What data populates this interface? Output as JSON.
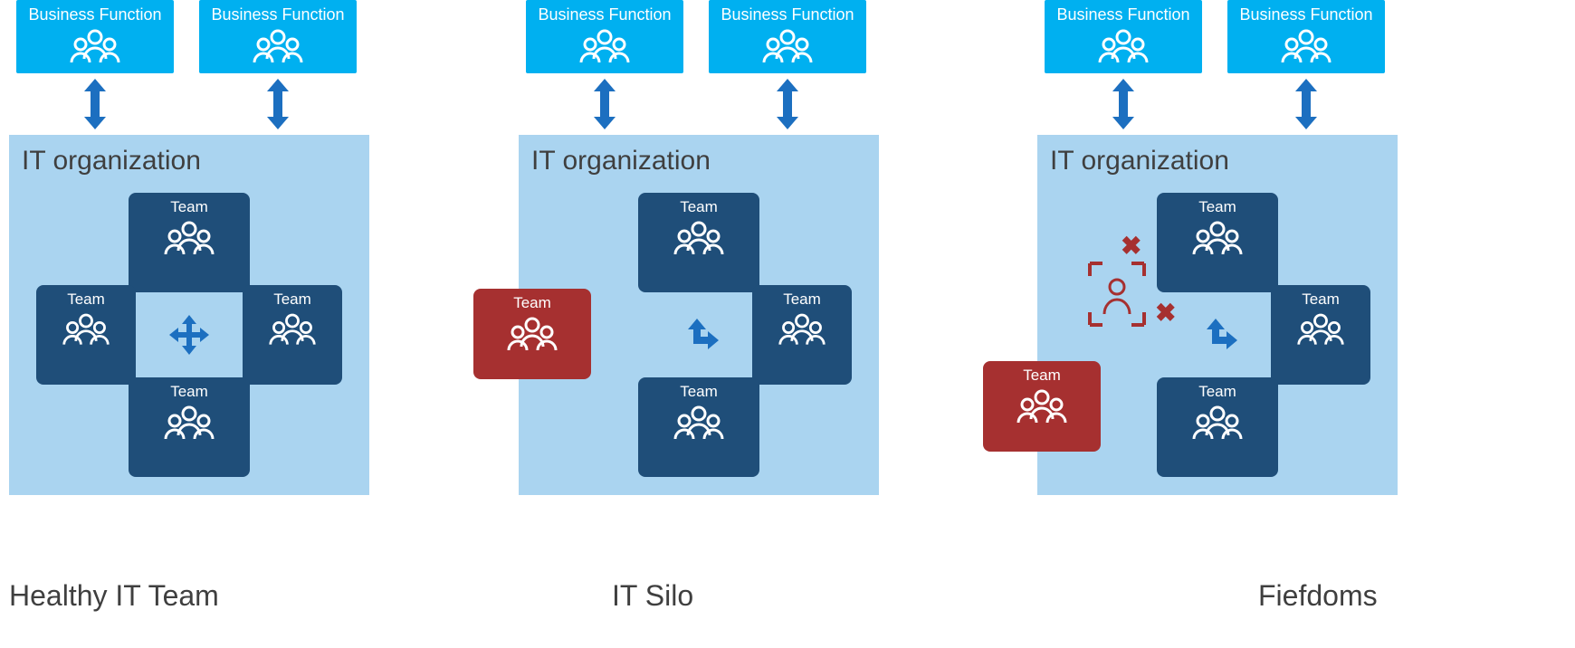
{
  "labels": {
    "business_function": "Business Function",
    "it_org": "IT organization",
    "team": "Team"
  },
  "columns": [
    {
      "caption": "Healthy IT Team",
      "type": "healthy"
    },
    {
      "caption": "IT Silo",
      "type": "silo"
    },
    {
      "caption": "Fiefdoms",
      "type": "fiefdoms"
    }
  ],
  "colors": {
    "business_function_bg": "#00b0f0",
    "org_bg": "#aad4f0",
    "team_bg": "#1f4e79",
    "team_isolated_bg": "#a63030",
    "arrow": "#1c6fc0",
    "text_dark": "#3f3f3f"
  }
}
